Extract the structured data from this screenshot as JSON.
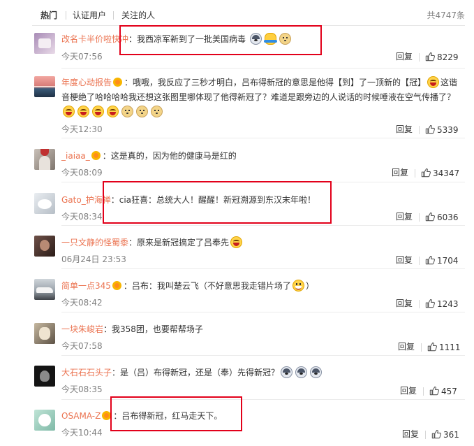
{
  "tabs": {
    "hot": "热门",
    "verified": "认证用户",
    "following": "关注的人",
    "total": "共4747条"
  },
  "comments": [
    {
      "username": "改名卡半价啦快冲",
      "vip": false,
      "separator": "：",
      "text": "我西凉军新到了一批美国病毒",
      "text2": "",
      "time": "今天07:56",
      "reply": "回复",
      "likes": "8229"
    },
    {
      "username": "年度心动报告",
      "vip": true,
      "separator": "：",
      "text": "哦哦，我反应了三秒才明白，吕布得新冠的意思是他得【到】了一顶新的【冠】",
      "text2": "这谐音梗绝了哈哈哈哈我还想这张图里哪体现了他得新冠了？难道是跟旁边的人说话的时候唾液在空气传播了？",
      "time": "今天12:30",
      "reply": "回复",
      "likes": "5339"
    },
    {
      "username": "_iaiaa_",
      "vip": true,
      "separator": "：",
      "text": "这是真的，因为他的健康马是红的",
      "text2": "",
      "time": "今天08:09",
      "reply": "回复",
      "likes": "34347"
    },
    {
      "username": "Gato_护海禅",
      "vip": false,
      "separator": "：",
      "text": "cia狂喜：总统大人！醒醒！新冠溯源到东汉末年啦！",
      "text2": "",
      "time": "今天08:34",
      "reply": "回复",
      "likes": "6036"
    },
    {
      "username": "一只文静的怪蜀黍",
      "vip": false,
      "separator": "：",
      "text": "原来是新冠搞定了吕奉先",
      "text2": "",
      "time": "06月24日 23:53",
      "reply": "回复",
      "likes": "1704"
    },
    {
      "username": "简单一点345",
      "vip": true,
      "separator": "：",
      "text": "吕布：我叫楚云飞（不好意思我走错片场了",
      "text2": "）",
      "time": "今天08:42",
      "reply": "回复",
      "likes": "1243"
    },
    {
      "username": "一块朱峻岩",
      "vip": false,
      "separator": "：",
      "text": "我358团，也要帮帮场子",
      "text2": "",
      "time": "今天07:58",
      "reply": "回复",
      "likes": "1111"
    },
    {
      "username": "大石石石头子",
      "vip": false,
      "separator": "：",
      "text": "是（吕）布得新冠，还是（奉）先得新冠？",
      "text2": "",
      "time": "今天08:35",
      "reply": "回复",
      "likes": "457"
    },
    {
      "username": "OSAMA-Z",
      "vip": true,
      "separator": "：",
      "text": "吕布得新冠，红马走天下。",
      "text2": "",
      "time": "今天10:44",
      "reply": "回复",
      "likes": "361"
    }
  ],
  "icons": {
    "emoji": [
      "husky-emoji-icon",
      "hug-emoji-icon",
      "doge-emoji-icon",
      "laugh-cry-emoji-icon",
      "grin-emoji-icon"
    ],
    "like": "thumbs-up-icon"
  },
  "colors": {
    "username": "#eb7350",
    "highlight": "#e2001a",
    "time": "#808080"
  }
}
